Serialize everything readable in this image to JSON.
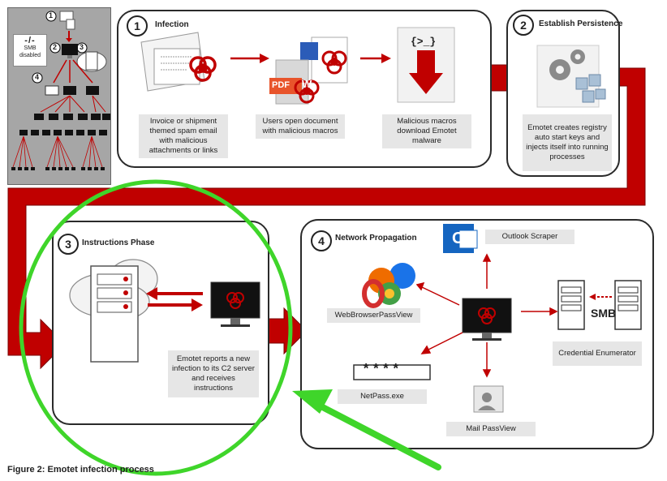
{
  "overview": {
    "smb_symbol": "-/-",
    "smb_label": "SMB disabled",
    "step_numbers": [
      "1",
      "2",
      "3",
      "4"
    ]
  },
  "panels": {
    "infection": {
      "number": "1",
      "title": "Infection",
      "captions": [
        "Invoice or shipment themed spam email with malicious attachments or links",
        "Users open document with malicious macros",
        "Malicious macros download Emotet malware"
      ],
      "doc_labels": {
        "word": "W",
        "pdf": "PDF",
        "shell": "{>_}"
      }
    },
    "persistence": {
      "number": "2",
      "title": "Establish Persistence",
      "caption": "Emotet creates registry auto start keys and injects itself into running processes"
    },
    "instructions": {
      "number": "3",
      "title": "Instructions Phase",
      "caption": "Emotet reports a new infection to its C2 server and receives instructions"
    },
    "propagation": {
      "number": "4",
      "title": "Network Propagation",
      "labels": {
        "outlook": "Outlook Scraper",
        "browser": "WebBrowserPassView",
        "netpass": "NetPass.exe",
        "mail": "Mail PassView",
        "credential": "Credential Enumerator",
        "smb": "SMB",
        "password_mask": "****",
        "outlook_letter": "O"
      }
    }
  },
  "figure_caption": "Figure 2: Emotet infection process",
  "colors": {
    "accent_red": "#c00000",
    "highlight_green": "#3fd52a",
    "caption_bg": "#e6e6e6",
    "overview_bg": "#a6a6a6"
  }
}
